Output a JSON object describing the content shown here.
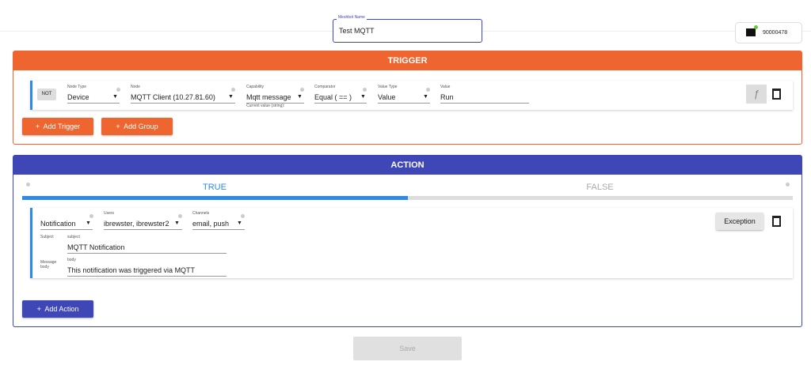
{
  "header": {
    "name_label": "Meshbot Name",
    "name_value": "Test MQTT",
    "device_id": "90000478"
  },
  "trigger": {
    "title": "TRIGGER",
    "not_label": "NOT",
    "fields": [
      {
        "label": "Node Type",
        "value": "Device"
      },
      {
        "label": "Node",
        "value": "MQTT Client (10.27.81.60)"
      },
      {
        "label": "Capability",
        "value": "Mqtt message",
        "hint": "Current value (string):"
      },
      {
        "label": "Comparator",
        "value": "Equal ( == )"
      },
      {
        "label": "Value Type",
        "value": "Value"
      },
      {
        "label": "Value",
        "value": "Run"
      }
    ],
    "function_icon": "ƒ",
    "add_trigger": "Add Trigger",
    "add_group": "Add Group"
  },
  "action": {
    "title": "ACTION",
    "tab_true": "TRUE",
    "tab_false": "FALSE",
    "true_progress": 50,
    "type": "Notification",
    "users_label": "Users",
    "users": "ibrewster, ibrewster2",
    "channels_label": "Channels",
    "channels": "email, push",
    "subject_label": "Subject",
    "subject_field_label": "subject",
    "subject": "MQTT Notification",
    "body_label": "Message body",
    "body_field_label": "body",
    "body": "This notification was triggered via MQTT",
    "exception": "Exception",
    "add_action": "Add Action"
  },
  "save": "Save",
  "colors": {
    "trigger": "#ef6530",
    "action": "#3f46b5",
    "tab": "#2d8ae6"
  }
}
